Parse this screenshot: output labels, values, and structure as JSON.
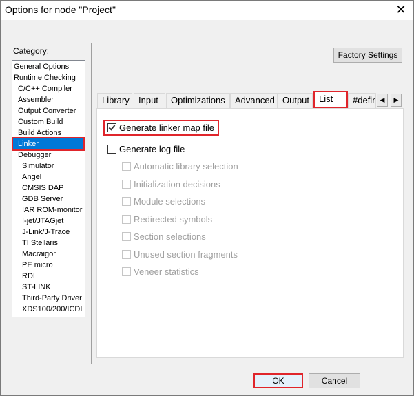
{
  "window": {
    "title": "Options for node \"Project\"",
    "close_glyph": "✕"
  },
  "category": {
    "label": "Category:",
    "items": [
      {
        "label": "General Options",
        "indent": 0
      },
      {
        "label": "Runtime Checking",
        "indent": 0
      },
      {
        "label": "C/C++ Compiler",
        "indent": 1
      },
      {
        "label": "Assembler",
        "indent": 1
      },
      {
        "label": "Output Converter",
        "indent": 1
      },
      {
        "label": "Custom Build",
        "indent": 1
      },
      {
        "label": "Build Actions",
        "indent": 1
      },
      {
        "label": "Linker",
        "indent": 1,
        "selected": true
      },
      {
        "label": "Debugger",
        "indent": 1
      },
      {
        "label": "Simulator",
        "indent": 2
      },
      {
        "label": "Angel",
        "indent": 2
      },
      {
        "label": "CMSIS DAP",
        "indent": 2
      },
      {
        "label": "GDB Server",
        "indent": 2
      },
      {
        "label": "IAR ROM-monitor",
        "indent": 2
      },
      {
        "label": "I-jet/JTAGjet",
        "indent": 2
      },
      {
        "label": "J-Link/J-Trace",
        "indent": 2
      },
      {
        "label": "TI Stellaris",
        "indent": 2
      },
      {
        "label": "Macraigor",
        "indent": 2
      },
      {
        "label": "PE micro",
        "indent": 2
      },
      {
        "label": "RDI",
        "indent": 2
      },
      {
        "label": "ST-LINK",
        "indent": 2
      },
      {
        "label": "Third-Party Driver",
        "indent": 2
      },
      {
        "label": "XDS100/200/ICDI",
        "indent": 2
      }
    ]
  },
  "factory_settings_label": "Factory Settings",
  "tabs": [
    {
      "label": "Library"
    },
    {
      "label": "Input"
    },
    {
      "label": "Optimizations"
    },
    {
      "label": "Advanced"
    },
    {
      "label": "Output"
    },
    {
      "label": "List",
      "active": true
    },
    {
      "label": "#defin"
    }
  ],
  "tab_scroll": {
    "left": "◀",
    "right": "▶"
  },
  "list_page": {
    "generate_map": {
      "label": "Generate linker map file",
      "checked": true
    },
    "generate_log": {
      "label": "Generate log file",
      "checked": false
    },
    "log_options": [
      "Automatic library selection",
      "Initialization decisions",
      "Module selections",
      "Redirected symbols",
      "Section selections",
      "Unused section fragments",
      "Veneer statistics"
    ]
  },
  "buttons": {
    "ok": "OK",
    "cancel": "Cancel"
  },
  "colors": {
    "selection": "#0078d7",
    "highlight": "#e0252b"
  }
}
